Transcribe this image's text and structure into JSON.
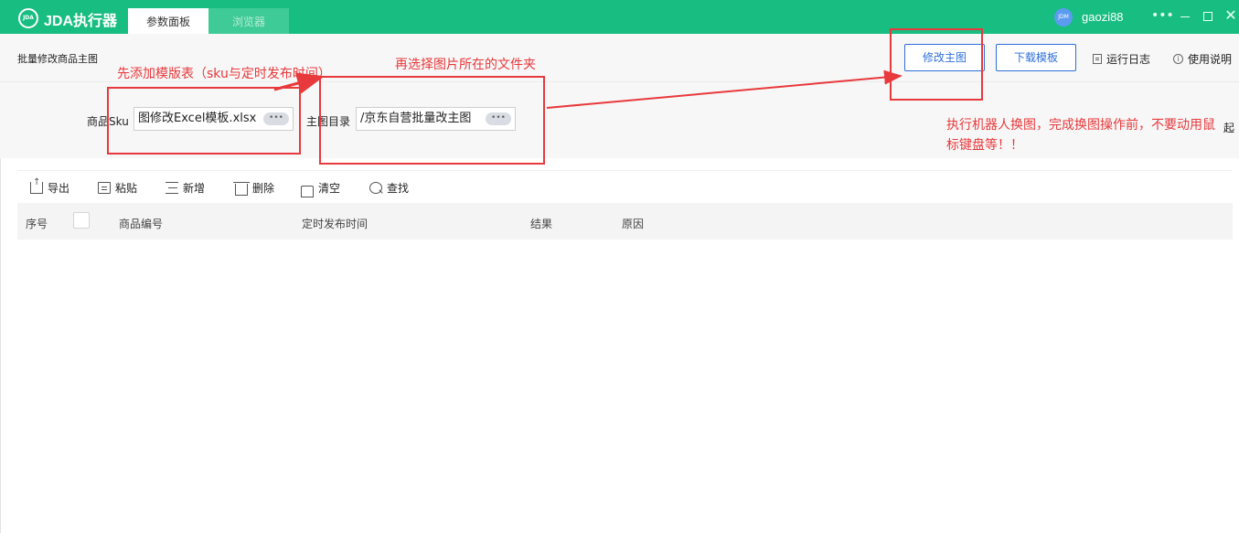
{
  "titlebar": {
    "logo_text": "JDA",
    "app_title": "JDA执行器",
    "tabs": [
      {
        "label": "参数面板",
        "active": true
      },
      {
        "label": "浏览器",
        "active": false
      }
    ],
    "avatar_text": "JDM",
    "username": "gaozi88",
    "more_glyph": "•••",
    "close_glyph": "✕",
    "accent_color": "#18bd82"
  },
  "header": {
    "page_title": "批量修改商品主图",
    "modify_button": "修改主图",
    "download_button": "下载模板",
    "log_link": "运行日志",
    "help_link": "使用说明",
    "info_glyph": "i"
  },
  "fields": {
    "sku_label": "商品Sku",
    "sku_value": "图修改Excel模板.xlsx",
    "dir_label": "主图目录",
    "dir_value": "/京东自营批量改主图",
    "browse_glyph": "•••",
    "side_text": "起"
  },
  "toolbar": {
    "export": "导出",
    "paste": "粘贴",
    "add": "新增",
    "delete": "删除",
    "clear": "清空",
    "find": "查找"
  },
  "table": {
    "columns": [
      "序号",
      "商品编号",
      "定时发布时间",
      "结果",
      "原因"
    ],
    "rows": []
  },
  "annotations": {
    "step1": "先添加模版表（sku与定时发布时间）",
    "step2": "再选择图片所在的文件夹",
    "warning": "执行机器人换图，完成换图操作前，不要动用鼠标键盘等！！",
    "color": "#e8393c"
  }
}
